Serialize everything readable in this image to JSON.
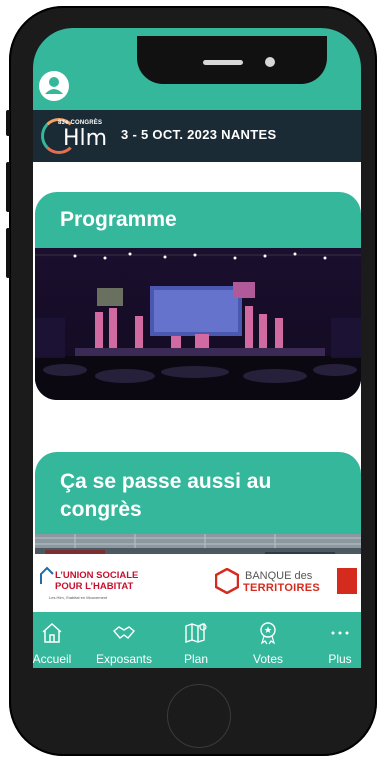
{
  "header": {
    "logo_small": "83e CONGRÈS",
    "logo_big": "Hlm",
    "event_info": "3 - 5 OCT. 2023 NANTES"
  },
  "cards": [
    {
      "title": "Programme"
    },
    {
      "title": "Ça se passe aussi au congrès"
    }
  ],
  "sponsors": {
    "ush_line1": "L’UNION SOCIALE",
    "ush_line2": "POUR L’HABITAT",
    "ush_tagline": "Les Hlm, l'habitat en Mouvement",
    "bdt_line1": "BANQUE des",
    "bdt_line2": "TERRITOIRES"
  },
  "tabs": [
    {
      "label": "Accueil",
      "icon": "home-icon"
    },
    {
      "label": "Exposants",
      "icon": "handshake-icon"
    },
    {
      "label": "Plan",
      "icon": "map-icon"
    },
    {
      "label": "Votes",
      "icon": "award-icon"
    },
    {
      "label": "Plus",
      "icon": "more-icon"
    }
  ],
  "colors": {
    "accent": "#35b79c",
    "header_bg": "#1b2b35",
    "sponsor_red": "#c8102e"
  }
}
